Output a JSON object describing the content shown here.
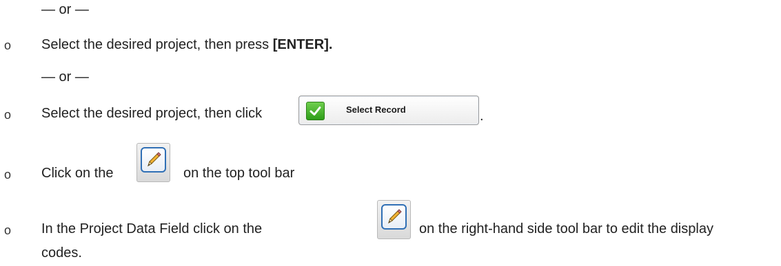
{
  "lines": {
    "or_1": "— or —",
    "step1_text": "Select the desired project, then press ",
    "step1_key": "[ENTER].",
    "or_2": "— or —",
    "step2_text": "Select the desired project, then click",
    "step2_end": ".",
    "step3_pre": "Click on the",
    "step3_post": "on the top tool bar",
    "step4_pre": "In the Project Data Field click on the",
    "step4_post": "on the right-hand side tool bar to edit the display",
    "step4_cont": "codes."
  },
  "bullet_char": "o",
  "select_record_button": {
    "label": "Select Record",
    "icon": "checkmark-icon"
  },
  "icons": {
    "edit": "pencil-icon"
  },
  "colors": {
    "text": "#222222",
    "check_green": "#2e9d19",
    "icon_border_blue": "#2f6fb5"
  }
}
